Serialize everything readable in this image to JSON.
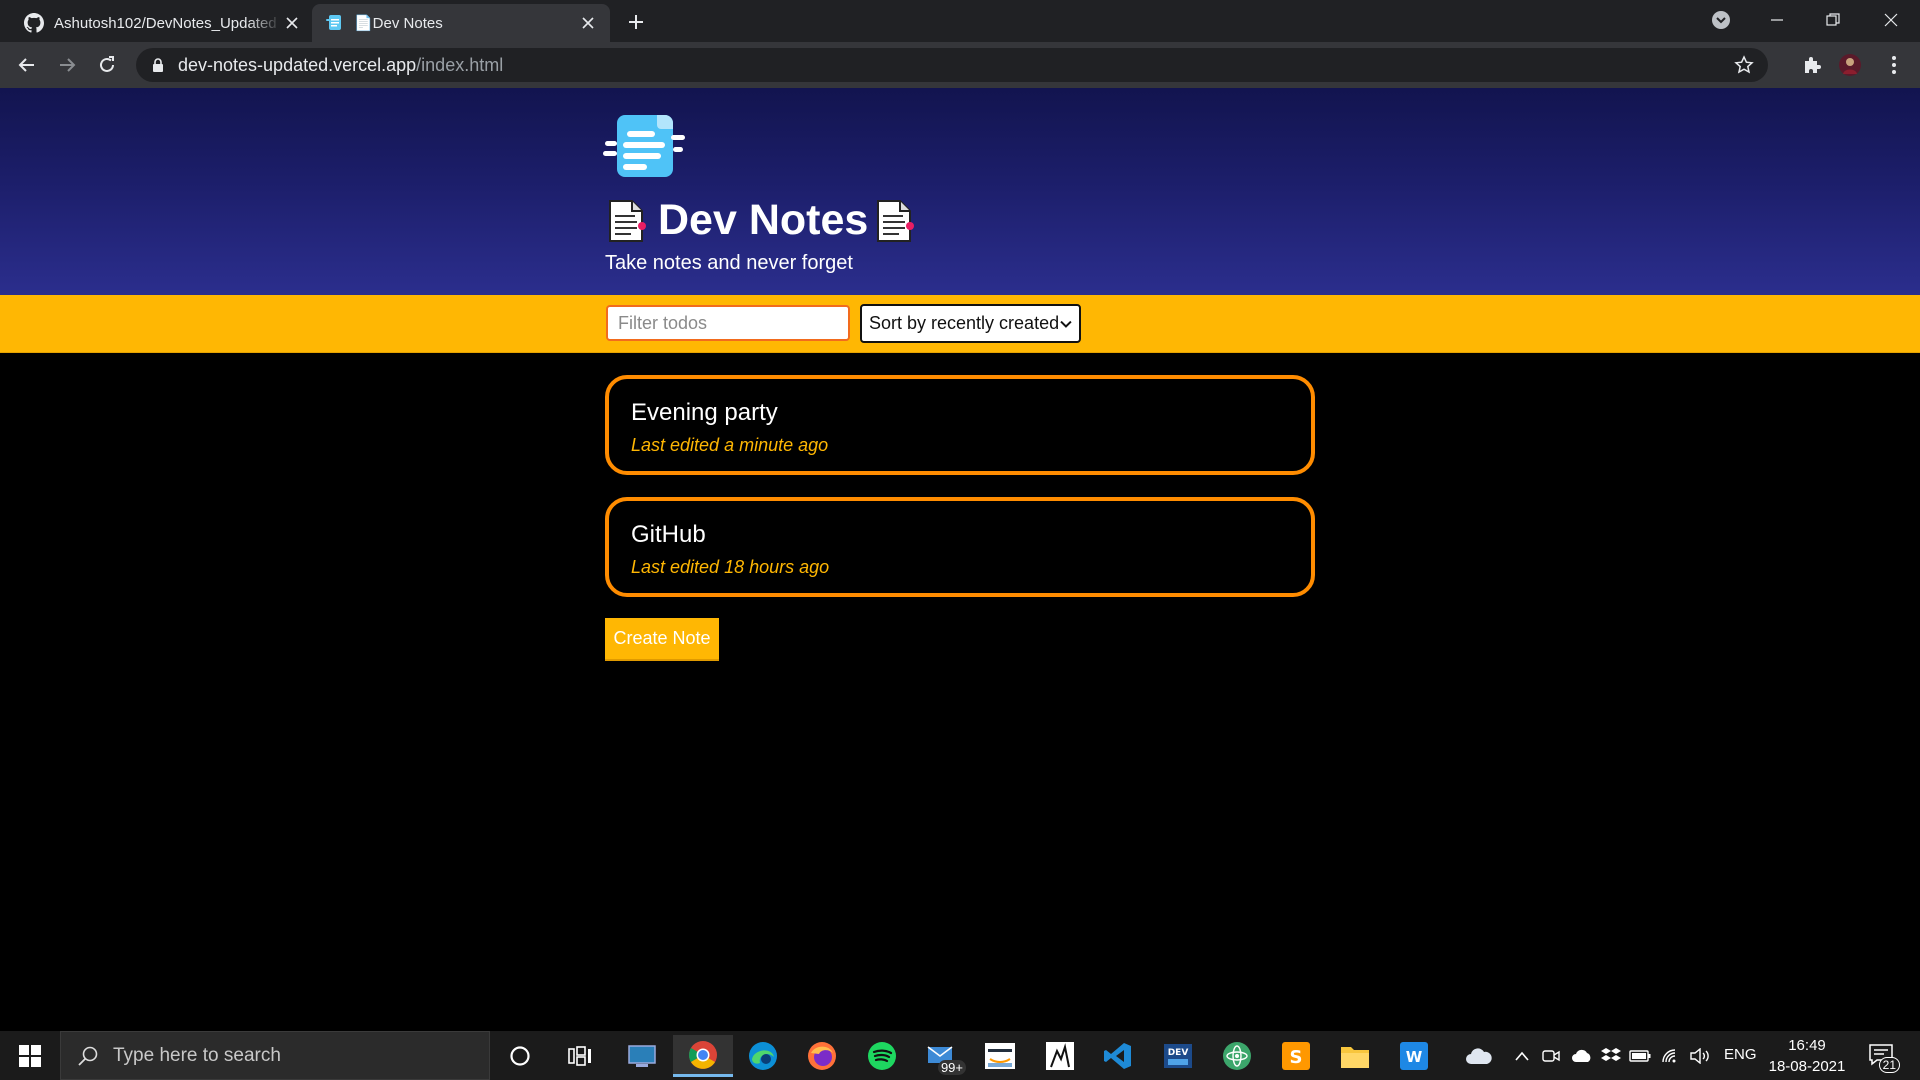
{
  "browser": {
    "tabs": [
      {
        "title": "Ashutosh102/DevNotes_Updated",
        "favicon": "github-icon",
        "active": false
      },
      {
        "title": "📄Dev Notes",
        "favicon": "notes-app-icon",
        "active": true
      }
    ],
    "url_host": "dev-notes-updated.vercel.app",
    "url_path": "/index.html"
  },
  "app": {
    "title": "Dev Notes",
    "subtitle": "Take notes and never forget",
    "filter_placeholder": "Filter todos",
    "filter_value": "",
    "sort_selected": "Sort by recently created",
    "create_label": "Create Note",
    "notes": [
      {
        "title": "Evening party",
        "meta": "Last edited a minute ago"
      },
      {
        "title": "GitHub",
        "meta": "Last edited 18 hours ago"
      }
    ],
    "colors": {
      "header_top": "#12144f",
      "header_bottom": "#2b2e8d",
      "filter_bar": "#ffb703",
      "note_border": "#ff8c00",
      "note_meta": "#ffb703",
      "background": "#000000"
    }
  },
  "taskbar": {
    "search_placeholder": "Type here to search",
    "apps": [
      "cortana-icon",
      "task-view-icon",
      "desktop-app-icon",
      "chrome-icon",
      "edge-icon",
      "firefox-icon",
      "spotify-icon",
      "mail-icon",
      "amazon-icon",
      "inkscape-icon",
      "vscode-icon",
      "devc-icon",
      "atom-icon",
      "sublime-icon",
      "file-explorer-icon",
      "word-icon"
    ],
    "mail_badge": "99+",
    "language": "ENG",
    "time": "16:49",
    "date": "18-08-2021",
    "notification_count": "21"
  }
}
